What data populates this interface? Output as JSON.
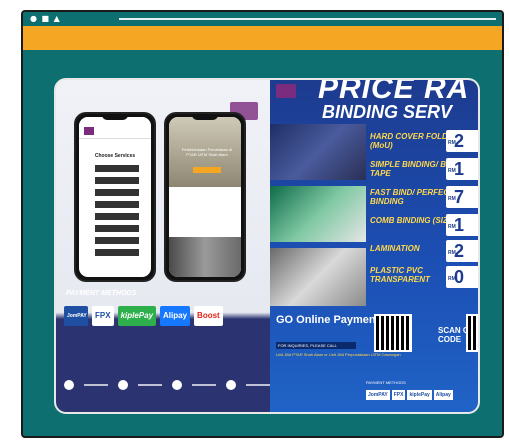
{
  "left_panel": {
    "phone1": {
      "title": "Choose Services",
      "buttons": 8
    },
    "phone2": {
      "headline": "Perkhidmatan Percetakan di PTAR UiTM Shah Alam"
    },
    "payment_methods_title": "PAYMENT METHODS",
    "payment_logos": [
      "JomPAY",
      "FPX",
      "kiplePay",
      "Alipay",
      "Boost"
    ]
  },
  "right_panel": {
    "headline_line1": "PRICE RA",
    "headline_line2": "BINDING SERV",
    "services": [
      {
        "name": "HARD COVER FOLDER (MoU)",
        "price": "2"
      },
      {
        "name": "SIMPLE BINDING/ BINDING TAPE",
        "price": "1"
      },
      {
        "name": "FAST BIND/ PERFECT BINDING",
        "price": "7"
      },
      {
        "name": "COMB BINDING (SIZE A4)",
        "price": "1"
      },
      {
        "name": "LAMINATION",
        "price": "2"
      },
      {
        "name": "PLASTIC PVC TRANSPARENT",
        "price": "0"
      }
    ],
    "currency": "RM",
    "go_online": "GO Online Payment",
    "enquiries": "FOR INQUIRIES, PLEASE CALL",
    "address": "Unit Jilid PTAR Shah Alam or Unit Jilid Perpustakaan UiTM Cawangan",
    "scan_label": "SCAN QR CODE",
    "payment_methods_label": "PAYMENT METHODS",
    "payment_strip": [
      "JomPAY",
      "FPX",
      "kiplePay",
      "Alipay"
    ]
  },
  "colors": {
    "frame": "#0d6f70",
    "accent": "#f5a623",
    "poster_blue": "#1d3b8f",
    "price_yellow": "#ffd84a"
  }
}
